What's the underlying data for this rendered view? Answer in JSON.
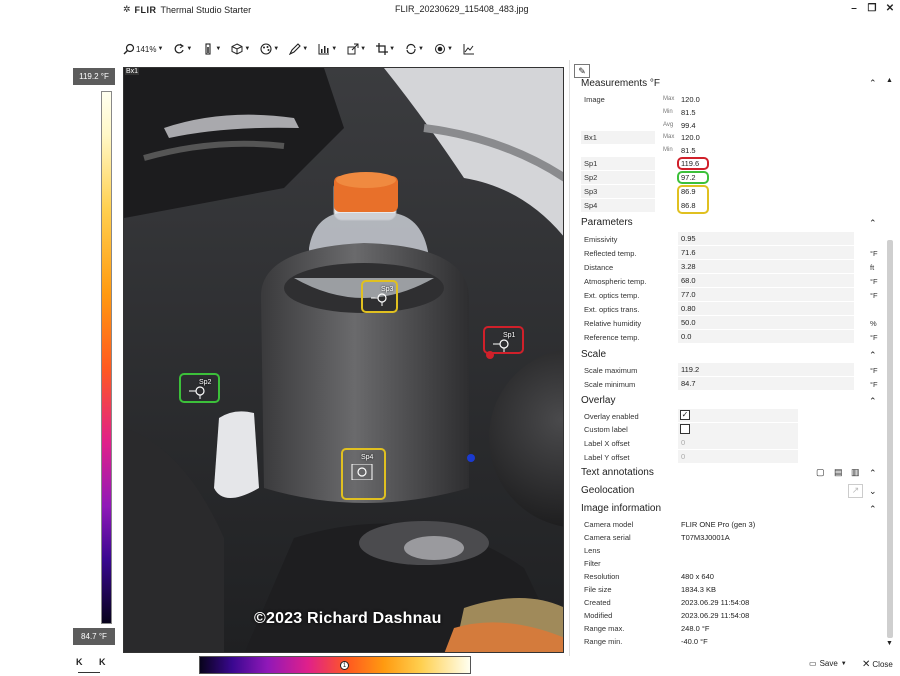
{
  "titlebar": {
    "brand": "FLIR",
    "app": "Thermal Studio Starter",
    "filename": "FLIR_20230629_115408_483.jpg",
    "minimize": "–",
    "restore": "❐",
    "close": "✕"
  },
  "toolbar": {
    "zoom_label": "141%"
  },
  "scale": {
    "max_label": "119.2 °F",
    "min_label": "84.7 °F"
  },
  "image": {
    "box_label": "Bx1",
    "watermark": "©2023 Richard Dashnau",
    "spots": [
      {
        "label": "Sp1",
        "color": "#d0202a"
      },
      {
        "label": "Sp2",
        "color": "#3cc03a"
      },
      {
        "label": "Sp3",
        "color": "#e0c020"
      },
      {
        "label": "Sp4",
        "color": "#e0c020"
      }
    ]
  },
  "nav": {
    "prev": "K",
    "next": "K"
  },
  "panel": {
    "measurements": {
      "title": "Measurements °F",
      "image_label": "Image",
      "max_label": "Max",
      "min_label": "Min",
      "avg_label": "Avg",
      "image_max": "120.0",
      "image_min": "81.5",
      "image_avg": "99.4",
      "bx1_label": "Bx1",
      "bx1_max": "120.0",
      "bx1_min": "81.5",
      "sp1_label": "Sp1",
      "sp1_value": "119.6",
      "sp2_label": "Sp2",
      "sp2_value": "97.2",
      "sp3_label": "Sp3",
      "sp3_value": "86.9",
      "sp4_label": "Sp4",
      "sp4_value": "86.8"
    },
    "parameters": {
      "title": "Parameters",
      "rows": [
        {
          "label": "Emissivity",
          "value": "0.95",
          "unit": ""
        },
        {
          "label": "Reflected temp.",
          "value": "71.6",
          "unit": "°F"
        },
        {
          "label": "Distance",
          "value": "3.28",
          "unit": "ft"
        },
        {
          "label": "Atmospheric temp.",
          "value": "68.0",
          "unit": "°F"
        },
        {
          "label": "Ext. optics temp.",
          "value": "77.0",
          "unit": "°F"
        },
        {
          "label": "Ext. optics trans.",
          "value": "0.80",
          "unit": ""
        },
        {
          "label": "Relative humidity",
          "value": "50.0",
          "unit": "%"
        },
        {
          "label": "Reference temp.",
          "value": "0.0",
          "unit": "°F"
        }
      ]
    },
    "scale": {
      "title": "Scale",
      "max_label": "Scale maximum",
      "max_value": "119.2",
      "min_label": "Scale minimum",
      "min_value": "84.7",
      "unit": "°F"
    },
    "overlay": {
      "title": "Overlay",
      "enabled_label": "Overlay enabled",
      "custom_label": "Custom label",
      "xoff_label": "Label X offset",
      "xoff_value": "0",
      "yoff_label": "Label Y offset",
      "yoff_value": "0"
    },
    "text_annotations": {
      "title": "Text annotations"
    },
    "geolocation": {
      "title": "Geolocation"
    },
    "image_information": {
      "title": "Image information",
      "rows": [
        {
          "label": "Camera model",
          "value": "FLIR ONE Pro (gen 3)"
        },
        {
          "label": "Camera serial",
          "value": "T07M3J0001A"
        },
        {
          "label": "Lens",
          "value": ""
        },
        {
          "label": "Filter",
          "value": ""
        },
        {
          "label": "Resolution",
          "value": "480 x 640"
        },
        {
          "label": "File size",
          "value": "1834.3 KB"
        },
        {
          "label": "Created",
          "value": "2023.06.29 11:54:08"
        },
        {
          "label": "Modified",
          "value": "2023.06.29 11:54:08"
        },
        {
          "label": "Range max.",
          "value": "248.0 °F"
        },
        {
          "label": "Range min.",
          "value": "-40.0 °F"
        }
      ]
    }
  },
  "footer": {
    "save": "Save",
    "close": "Close"
  }
}
